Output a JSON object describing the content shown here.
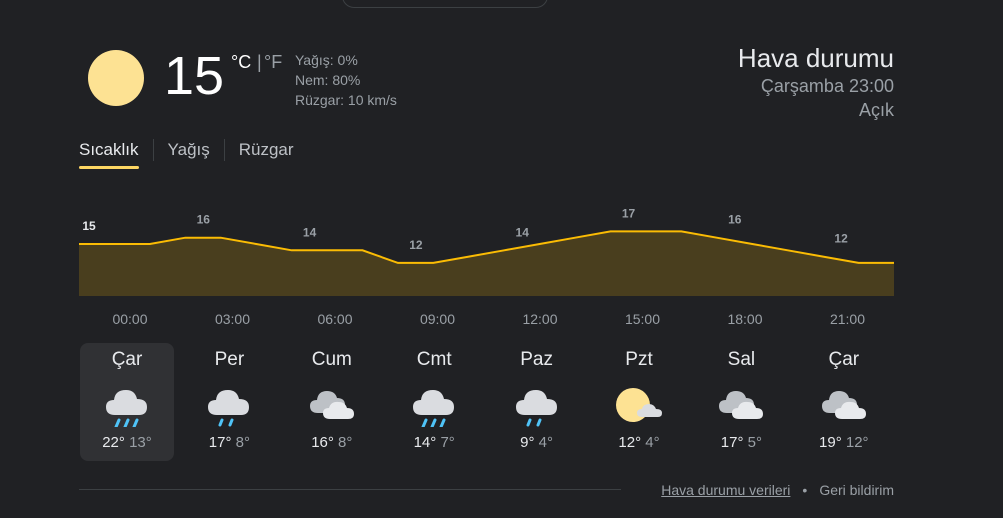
{
  "current": {
    "temperature": "15",
    "unit_celsius": "°C",
    "unit_separator": "|",
    "unit_fahrenheit": "°F",
    "precipitation": "Yağış: 0%",
    "humidity": "Nem: 80%",
    "wind": "Rüzgar: 10 km/s",
    "icon": "sun-icon"
  },
  "header": {
    "title": "Hava durumu",
    "datetime": "Çarşamba 23:00",
    "condition": "Açık"
  },
  "tabs": [
    {
      "label": "Sıcaklık",
      "active": true
    },
    {
      "label": "Yağış",
      "active": false
    },
    {
      "label": "Rüzgar",
      "active": false
    }
  ],
  "chart_data": {
    "type": "area",
    "x": [
      "00:00",
      "01:00",
      "02:00",
      "03:00",
      "04:00",
      "05:00",
      "06:00",
      "07:00",
      "08:00",
      "09:00",
      "10:00",
      "11:00",
      "12:00",
      "13:00",
      "14:00",
      "15:00",
      "16:00",
      "17:00",
      "18:00",
      "19:00",
      "20:00",
      "21:00",
      "22:00",
      "23:00"
    ],
    "values": [
      15,
      15,
      15,
      16,
      16,
      15,
      14,
      14,
      14,
      12,
      12,
      13,
      14,
      15,
      16,
      17,
      17,
      17,
      16,
      15,
      14,
      13,
      12,
      12
    ],
    "labels": [
      {
        "x": "00:00",
        "value": "15"
      },
      {
        "x": "03:00",
        "value": "16"
      },
      {
        "x": "06:00",
        "value": "14"
      },
      {
        "x": "09:00",
        "value": "12"
      },
      {
        "x": "12:00",
        "value": "14"
      },
      {
        "x": "15:00",
        "value": "17"
      },
      {
        "x": "18:00",
        "value": "16"
      },
      {
        "x": "21:00",
        "value": "12"
      }
    ],
    "xticks": [
      "00:00",
      "03:00",
      "06:00",
      "09:00",
      "12:00",
      "15:00",
      "18:00",
      "21:00"
    ],
    "line_color": "#fbbc04",
    "fill_color": "#493e1e"
  },
  "days": [
    {
      "name": "Çar",
      "icon": "rain-icon",
      "high": "22°",
      "low": "13°",
      "selected": true
    },
    {
      "name": "Per",
      "icon": "light-rain-icon",
      "high": "17°",
      "low": "8°",
      "selected": false
    },
    {
      "name": "Cum",
      "icon": "cloudy-icon",
      "high": "16°",
      "low": "8°",
      "selected": false
    },
    {
      "name": "Cmt",
      "icon": "rain-icon",
      "high": "14°",
      "low": "7°",
      "selected": false
    },
    {
      "name": "Paz",
      "icon": "light-rain-icon",
      "high": "9°",
      "low": "4°",
      "selected": false
    },
    {
      "name": "Pzt",
      "icon": "partly-cloudy-icon",
      "high": "12°",
      "low": "4°",
      "selected": false
    },
    {
      "name": "Sal",
      "icon": "cloudy-icon",
      "high": "17°",
      "low": "5°",
      "selected": false
    },
    {
      "name": "Çar",
      "icon": "cloudy-icon",
      "high": "19°",
      "low": "12°",
      "selected": false
    }
  ],
  "footer": {
    "data_link": "Hava durumu verileri",
    "separator": "•",
    "feedback": "Geri bildirim"
  },
  "colors": {
    "background": "#202124",
    "sun": "#fde293",
    "accent": "#fdd663",
    "rain": "#4fc3f7"
  }
}
